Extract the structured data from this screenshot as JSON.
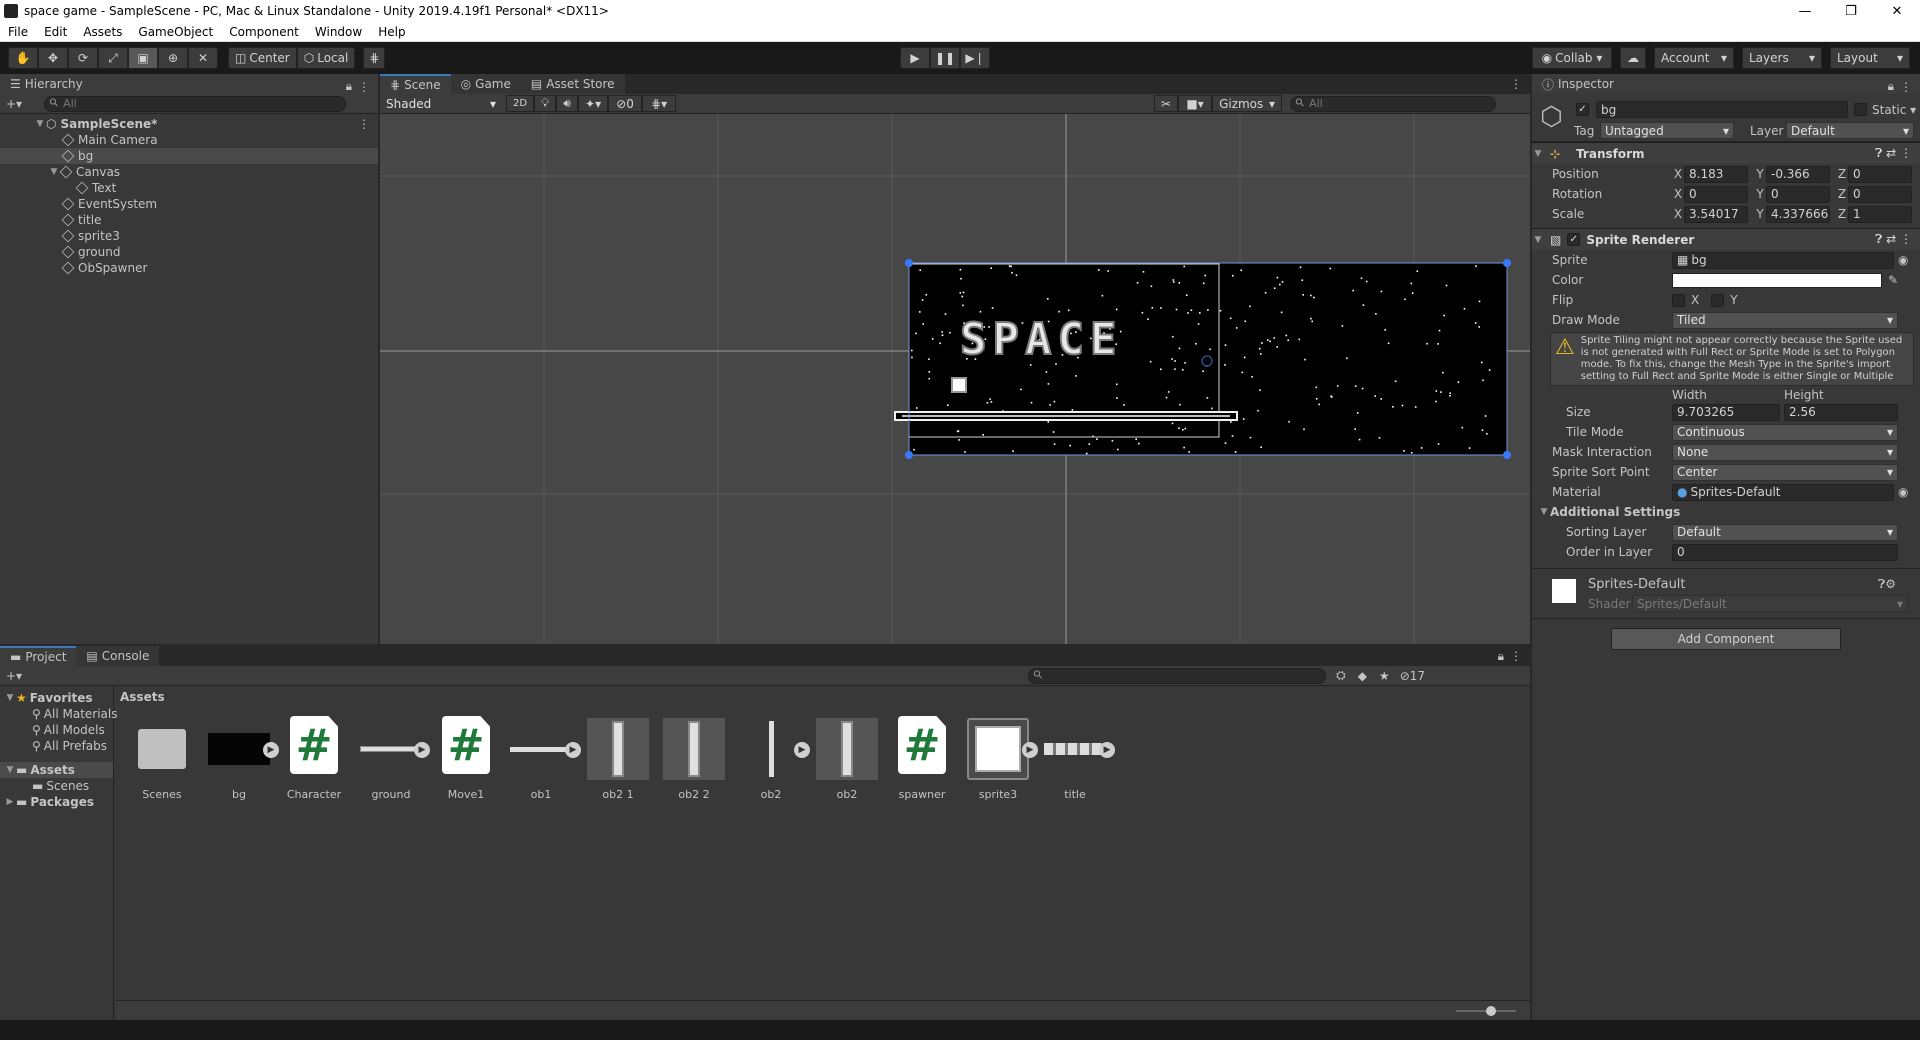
{
  "window": {
    "title": "space game - SampleScene - PC, Mac & Linux Standalone - Unity 2019.4.19f1 Personal* <DX11>",
    "controls": [
      "—",
      "❐",
      "✕"
    ]
  },
  "menu": [
    "File",
    "Edit",
    "Assets",
    "GameObject",
    "Component",
    "Window",
    "Help"
  ],
  "toolbar": {
    "pivot": "Center",
    "space": "Local",
    "collab": "Collab ▾",
    "account": "Account",
    "layers": "Layers",
    "layout": "Layout"
  },
  "hierarchy": {
    "tab": "Hierarchy",
    "search_placeholder": "All",
    "add": "+▾",
    "scene": "SampleScene*",
    "items": [
      "Main Camera",
      "bg",
      "Canvas",
      "Text",
      "EventSystem",
      "title",
      "sprite3",
      "ground",
      "ObSpawner"
    ]
  },
  "scene_view": {
    "tabs": [
      "Scene",
      "Game",
      "Asset Store"
    ],
    "shading": "Shaded",
    "mode_2d": "2D",
    "hidden_count": "0",
    "gizmos": "Gizmos",
    "search_placeholder": "All",
    "title_text": "SPACE"
  },
  "inspector": {
    "tab": "Inspector",
    "object_name": "bg",
    "static_label": "Static",
    "tag_label": "Tag",
    "tag_value": "Untagged",
    "layer_label": "Layer",
    "layer_value": "Default",
    "transform": {
      "title": "Transform",
      "position_label": "Position",
      "position": [
        "8.183",
        "-0.366",
        "0"
      ],
      "rotation_label": "Rotation",
      "rotation": [
        "0",
        "0",
        "0"
      ],
      "scale_label": "Scale",
      "scale": [
        "3.54017",
        "4.337666",
        "1"
      ],
      "axes": [
        "X",
        "Y",
        "Z"
      ]
    },
    "sprite_renderer": {
      "title": "Sprite Renderer",
      "sprite_label": "Sprite",
      "sprite_value": "bg",
      "color_label": "Color",
      "flip_label": "Flip",
      "flip_x": "X",
      "flip_y": "Y",
      "draw_mode_label": "Draw Mode",
      "draw_mode_value": "Tiled",
      "warning": "Sprite Tiling might not appear correctly because the Sprite used is not generated with Full Rect or Sprite Mode is set to Polygon mode. To fix this, change the Mesh Type in the Sprite's import setting to Full Rect and Sprite Mode is either Single or Multiple",
      "size_label": "Size",
      "width_label": "Width",
      "height_label": "Height",
      "width_value": "9.703265",
      "height_value": "2.56",
      "tile_mode_label": "Tile Mode",
      "tile_mode_value": "Continuous",
      "mask_label": "Mask Interaction",
      "mask_value": "None",
      "sort_point_label": "Sprite Sort Point",
      "sort_point_value": "Center",
      "material_label": "Material",
      "material_value": "Sprites-Default",
      "additional_label": "Additional Settings",
      "sorting_layer_label": "Sorting Layer",
      "sorting_layer_value": "Default",
      "order_label": "Order in Layer",
      "order_value": "0"
    },
    "material": {
      "name": "Sprites-Default",
      "shader_label": "Shader",
      "shader_value": "Sprites/Default"
    },
    "add_component": "Add Component"
  },
  "project": {
    "tabs": [
      "Project",
      "Console"
    ],
    "add": "+▾",
    "hidden_count": "17",
    "favorites_label": "Favorites",
    "favorites": [
      "All Materials",
      "All Models",
      "All Prefabs"
    ],
    "assets_label": "Assets",
    "assets_children": [
      "Scenes"
    ],
    "packages_label": "Packages",
    "breadcrumb": "Assets",
    "assets": [
      "Scenes",
      "bg",
      "Character",
      "ground",
      "Move1",
      "ob1",
      "ob2 1",
      "ob2 2",
      "ob2",
      "ob2",
      "spawner",
      "sprite3",
      "title"
    ]
  },
  "colors": {
    "accent": "#3a79bb",
    "panel": "#383838",
    "dark": "#191919",
    "script_green": "#1f7a3a"
  }
}
